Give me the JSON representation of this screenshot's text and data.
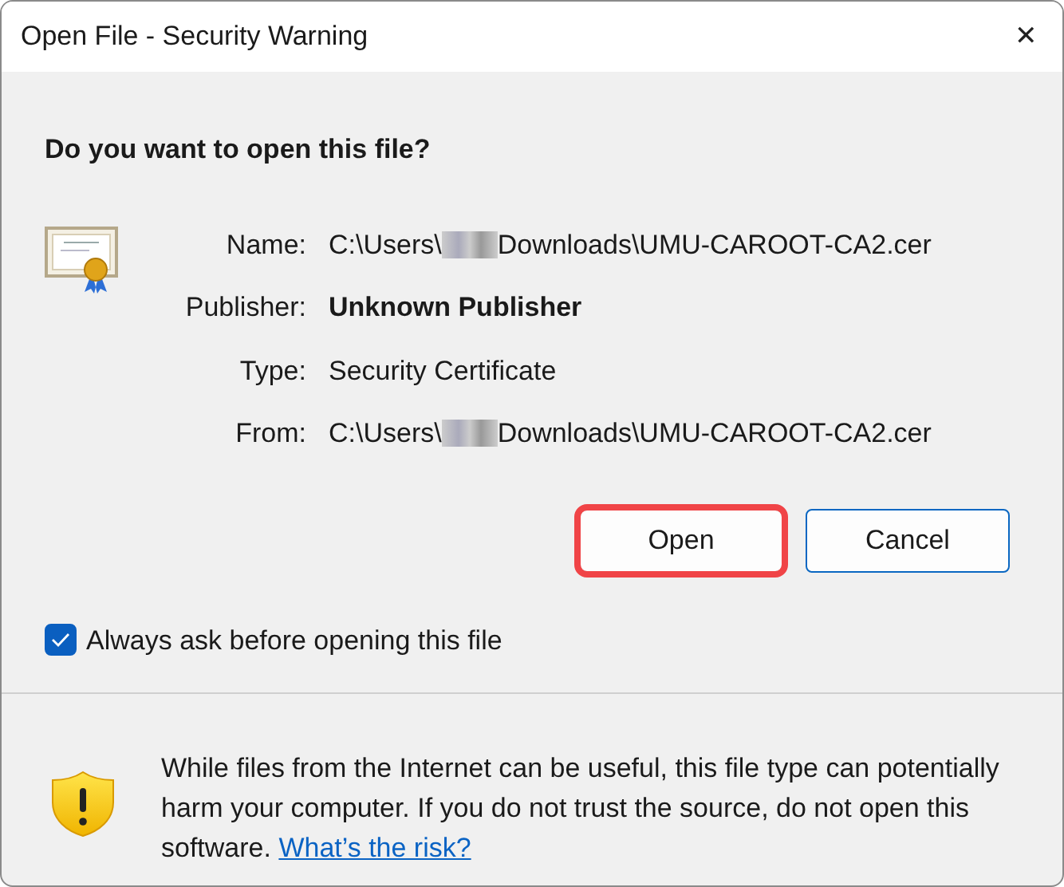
{
  "window": {
    "title": "Open File - Security Warning",
    "close": "✕"
  },
  "question": "Do you want to open this file?",
  "fields": [
    {
      "label": "Name:",
      "kind": "path",
      "prefix": "C:\\Users\\",
      "suffix": "Downloads\\UMU-CAROOT-CA2.cer"
    },
    {
      "label": "Publisher:",
      "kind": "bold",
      "value": "Unknown Publisher"
    },
    {
      "label": "Type:",
      "kind": "plain",
      "value": "Security Certificate"
    },
    {
      "label": "From:",
      "kind": "path",
      "prefix": "C:\\Users\\",
      "suffix": "Downloads\\UMU-CAROOT-CA2.cer"
    }
  ],
  "buttons": [
    {
      "label": "Open",
      "highlighted": true,
      "focused": false
    },
    {
      "label": "Cancel",
      "highlighted": false,
      "focused": true
    }
  ],
  "always_ask": {
    "label": "Always ask before opening this file",
    "checked": true
  },
  "warning": {
    "text": "While files from the Internet can be useful, this file type can potentially harm your computer. If you do not trust the source, do not open this software.",
    "link": "What’s the risk?"
  }
}
